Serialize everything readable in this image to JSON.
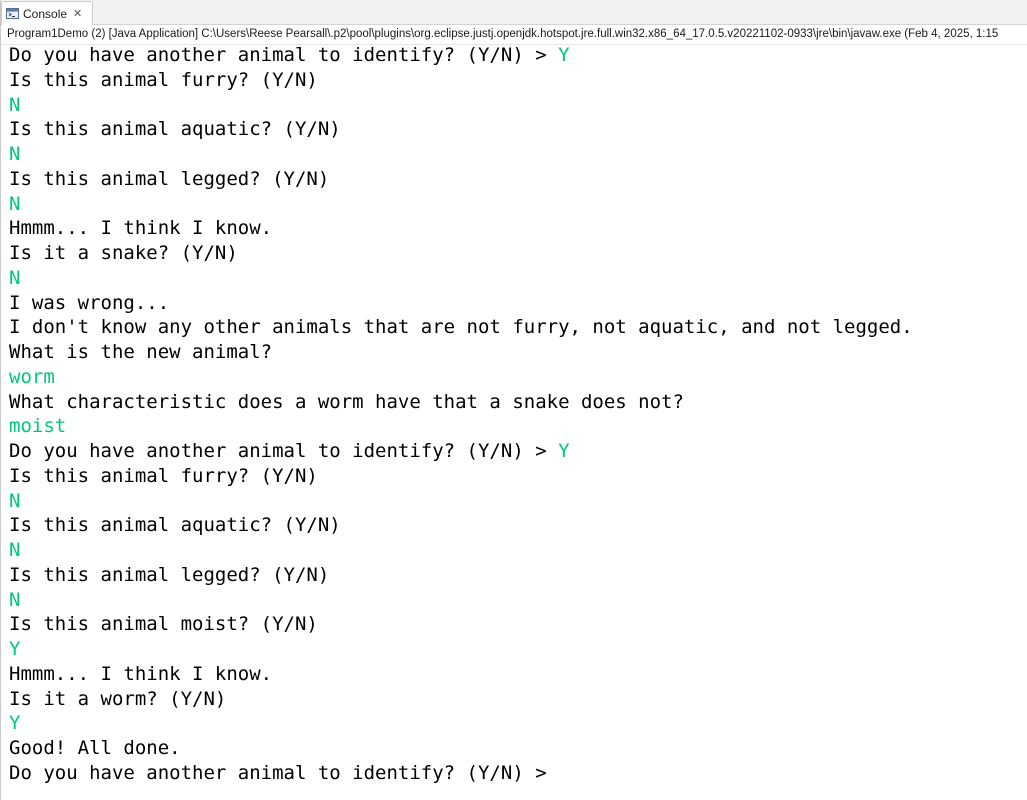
{
  "tab": {
    "label": "Console",
    "icon": "console-icon",
    "close_glyph": "✕"
  },
  "status_line": "Program1Demo (2) [Java Application] C:\\Users\\Reese Pearsall\\.p2\\pool\\plugins\\org.eclipse.justj.openjdk.hotspot.jre.full.win32.x86_64_17.0.5.v20221102-0933\\jre\\bin\\javaw.exe  (Feb 4, 2025, 1:15",
  "colors": {
    "user_input": "#00c87a",
    "output": "#000000"
  },
  "console_lines": [
    {
      "out": "Do you have another animal to identify? (Y/N) > ",
      "in": "Y"
    },
    {
      "out": "Is this animal furry? (Y/N)",
      "in": ""
    },
    {
      "out": "",
      "in": "N"
    },
    {
      "out": "Is this animal aquatic? (Y/N)",
      "in": ""
    },
    {
      "out": "",
      "in": "N"
    },
    {
      "out": "Is this animal legged? (Y/N)",
      "in": ""
    },
    {
      "out": "",
      "in": "N"
    },
    {
      "out": "Hmmm... I think I know.",
      "in": ""
    },
    {
      "out": "Is it a snake? (Y/N)",
      "in": ""
    },
    {
      "out": "",
      "in": "N"
    },
    {
      "out": "I was wrong...",
      "in": ""
    },
    {
      "out": "I don't know any other animals that are not furry, not aquatic, and not legged.",
      "in": ""
    },
    {
      "out": "What is the new animal?",
      "in": ""
    },
    {
      "out": "",
      "in": "worm"
    },
    {
      "out": "What characteristic does a worm have that a snake does not?",
      "in": ""
    },
    {
      "out": "",
      "in": "moist"
    },
    {
      "out": "Do you have another animal to identify? (Y/N) > ",
      "in": "Y"
    },
    {
      "out": "Is this animal furry? (Y/N)",
      "in": ""
    },
    {
      "out": "",
      "in": "N"
    },
    {
      "out": "Is this animal aquatic? (Y/N)",
      "in": ""
    },
    {
      "out": "",
      "in": "N"
    },
    {
      "out": "Is this animal legged? (Y/N)",
      "in": ""
    },
    {
      "out": "",
      "in": "N"
    },
    {
      "out": "Is this animal moist? (Y/N)",
      "in": ""
    },
    {
      "out": "",
      "in": "Y"
    },
    {
      "out": "Hmmm... I think I know.",
      "in": ""
    },
    {
      "out": "Is it a worm? (Y/N)",
      "in": ""
    },
    {
      "out": "",
      "in": "Y"
    },
    {
      "out": "Good! All done.",
      "in": ""
    },
    {
      "out": "Do you have another animal to identify? (Y/N) > ",
      "in": ""
    }
  ]
}
